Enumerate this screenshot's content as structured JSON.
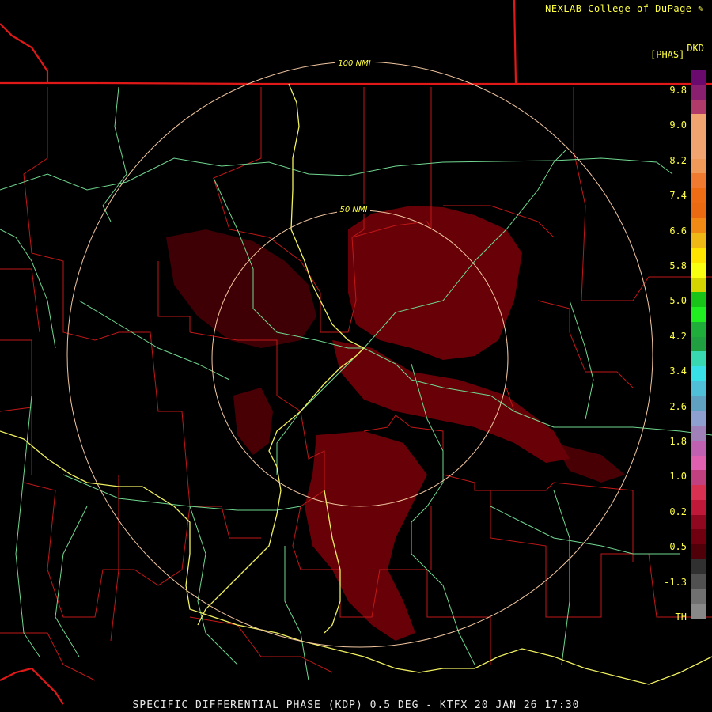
{
  "credit": "NEXLAB-College of DuPage",
  "credit_icon": "pencil-icon",
  "product_unit_top": "DKD",
  "product_unit_bottom": "[PHAS]",
  "footer_caption": "SPECIFIC DIFFERENTIAL PHASE (KDP) 0.5 DEG - KTFX 20 JAN 26 17:30",
  "range_rings": [
    {
      "label": "50 NMI"
    },
    {
      "label": "100 NMI"
    }
  ],
  "legend": {
    "ticks": [
      "9.8",
      "9.0",
      "8.2",
      "7.4",
      "6.6",
      "5.8",
      "5.0",
      "4.2",
      "3.4",
      "2.6",
      "1.8",
      "1.0",
      "0.2",
      "-0.5",
      "-1.3",
      "TH"
    ],
    "colors": [
      "#6a0a6e",
      "#8a1f70",
      "#b03a6a",
      "#f2a470",
      "#f2a470",
      "#f2a470",
      "#f09a5a",
      "#f07a30",
      "#ee6d14",
      "#ea6a12",
      "#f08a14",
      "#f0b814",
      "#ffe400",
      "#f8ff10",
      "#d4d400",
      "#17c417",
      "#20ee20",
      "#1fae3a",
      "#20a040",
      "#38d8b0",
      "#38e0e8",
      "#50c0d8",
      "#60a0c0",
      "#8ea0d0",
      "#a080b8",
      "#c060b0",
      "#e060b0",
      "#c04080",
      "#d83050",
      "#c01838",
      "#900820",
      "#700010",
      "#500008",
      "#303030",
      "#505050",
      "#707070",
      "#888888",
      "#000000"
    ]
  },
  "colors": {
    "state_border": "#e01818",
    "county_border": "#c01818",
    "highway": "#f0f060",
    "road": "#70d890",
    "ring": "#f2c6a0",
    "echo": "#6e0008"
  }
}
